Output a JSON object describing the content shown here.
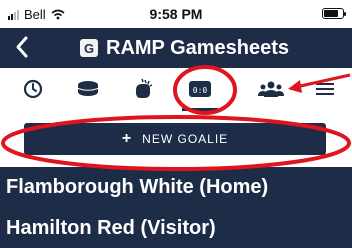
{
  "status_bar": {
    "carrier": "Bell",
    "time": "9:58 PM",
    "icons": [
      "signal-icon",
      "wifi-icon",
      "battery-icon"
    ]
  },
  "nav": {
    "title": "RAMP Gamesheets",
    "logo_letter": "G"
  },
  "tabs": [
    {
      "icon": "clock-icon"
    },
    {
      "icon": "puck-icon"
    },
    {
      "icon": "penalty-icon"
    },
    {
      "icon": "scoreboard-icon",
      "label": "0:0",
      "active": true
    },
    {
      "icon": "players-icon"
    },
    {
      "icon": "menu-icon"
    }
  ],
  "new_goalie_button": {
    "label": "NEW GOALIE"
  },
  "teams": [
    {
      "name": "Flamborough White (Home)"
    },
    {
      "name": "Hamilton Red (Visitor)"
    }
  ],
  "colors": {
    "navy": "#1e2d47",
    "annotation_red": "#e0141e"
  }
}
